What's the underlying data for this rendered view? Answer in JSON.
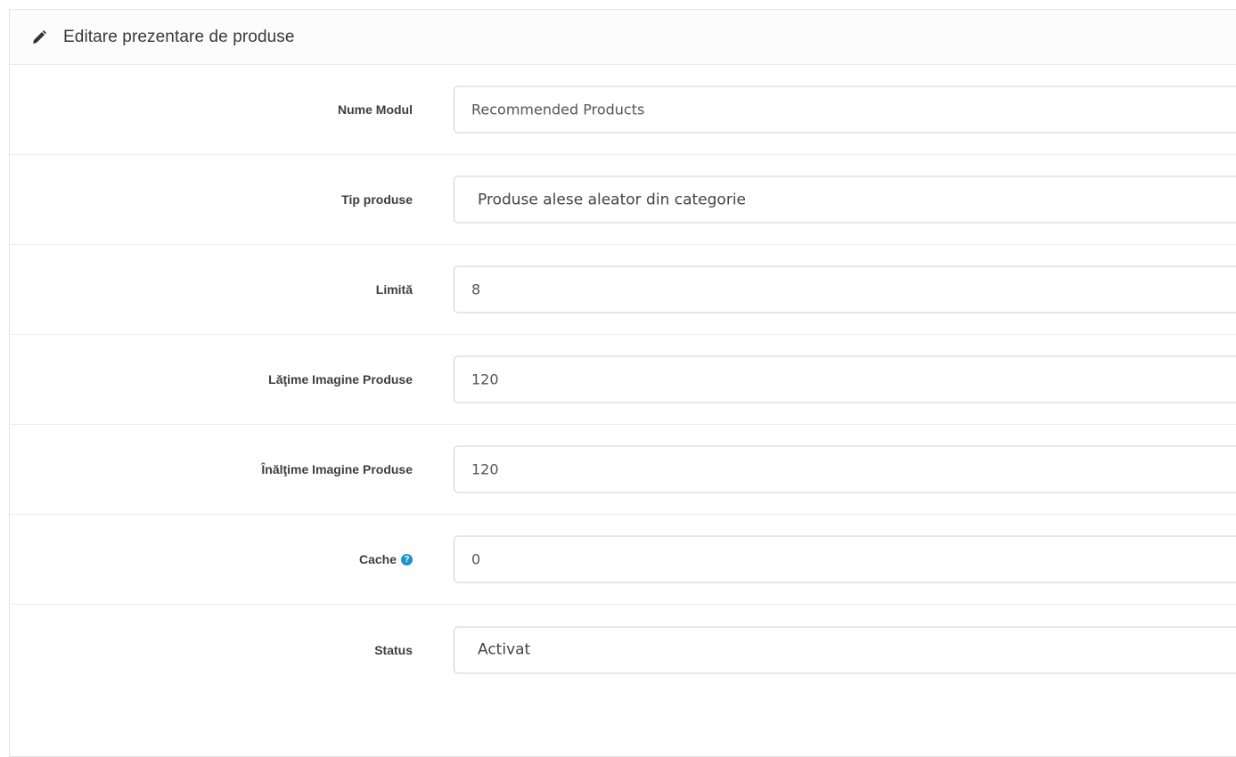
{
  "panel": {
    "title": "Editare prezentare de produse",
    "icon": "pencil-icon"
  },
  "form": {
    "module_name": {
      "label": "Nume Modul",
      "value": "Recommended Products"
    },
    "product_type": {
      "label": "Tip produse",
      "value": "Produse alese aleator din categorie"
    },
    "limit": {
      "label": "Limită",
      "value": "8"
    },
    "image_width": {
      "label": "Lăţime Imagine Produse",
      "value": "120"
    },
    "image_height": {
      "label": "Înălţime Imagine Produse",
      "value": "120"
    },
    "cache": {
      "label": "Cache",
      "value": "0",
      "help_icon": "question-circle-icon"
    },
    "status": {
      "label": "Status",
      "value": "Activat"
    }
  },
  "colors": {
    "help_icon": "#1e91cf",
    "border": "#cfcfcf"
  }
}
